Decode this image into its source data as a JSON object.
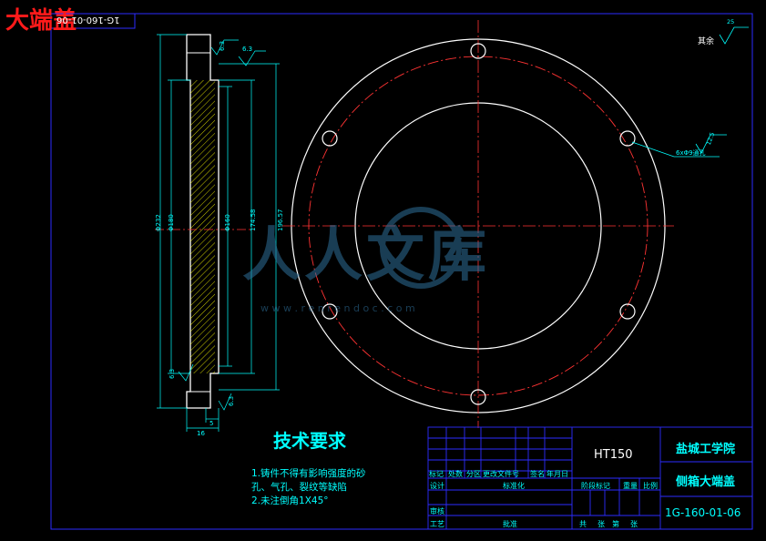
{
  "drawing": {
    "title": "大端盖",
    "mirrored_code": "1G-160-01-06",
    "roughness_rest_label": "其余",
    "roughness_rest_value": "25"
  },
  "section_view": {
    "roughness_top": "6.3",
    "roughness_face": "6.3",
    "roughness_bottom_left": "6.3",
    "roughness_bottom_right": "6.3",
    "dim_outer": "Φ232",
    "dim_mid": "Φ180",
    "dim_inner": "Φ160",
    "dim_bore": "174.58",
    "dim_total": "196.57",
    "dim_bottom": "16",
    "dim_step": "5"
  },
  "front_view": {
    "hole_note": "6xΦ9通孔",
    "hole_roughness": "12.5"
  },
  "tech_requirements": {
    "title": "技术要求",
    "items": [
      "1.铸件不得有影响强度的砂",
      "孔、气孔、裂纹等缺陷",
      "2.未注倒角1X45°"
    ]
  },
  "title_block": {
    "material": "HT150",
    "school": "盐城工学院",
    "part_name": "侧箱大端盖",
    "drawing_no": "1G-160-01-06",
    "headers": [
      "标记",
      "处数",
      "分区",
      "更改文件号",
      "签名",
      "年月日"
    ],
    "row_design": [
      "设计",
      "标准化"
    ],
    "row_review": "审核",
    "row_process": [
      "工艺",
      "批准"
    ],
    "stage_labels": [
      "阶段标记",
      "重量",
      "比例"
    ],
    "sheet_labels": [
      "共",
      "张",
      "第",
      "张"
    ]
  },
  "watermark": {
    "text": "人人文库",
    "url": "w w w . r e n r e n d o c . c o m"
  },
  "colors": {
    "background": "#000000",
    "outline": "#ffffff",
    "dimension": "#00ffff",
    "center": "#ff3333",
    "frame": "#2d2dff",
    "hatch": "#ffff00"
  }
}
